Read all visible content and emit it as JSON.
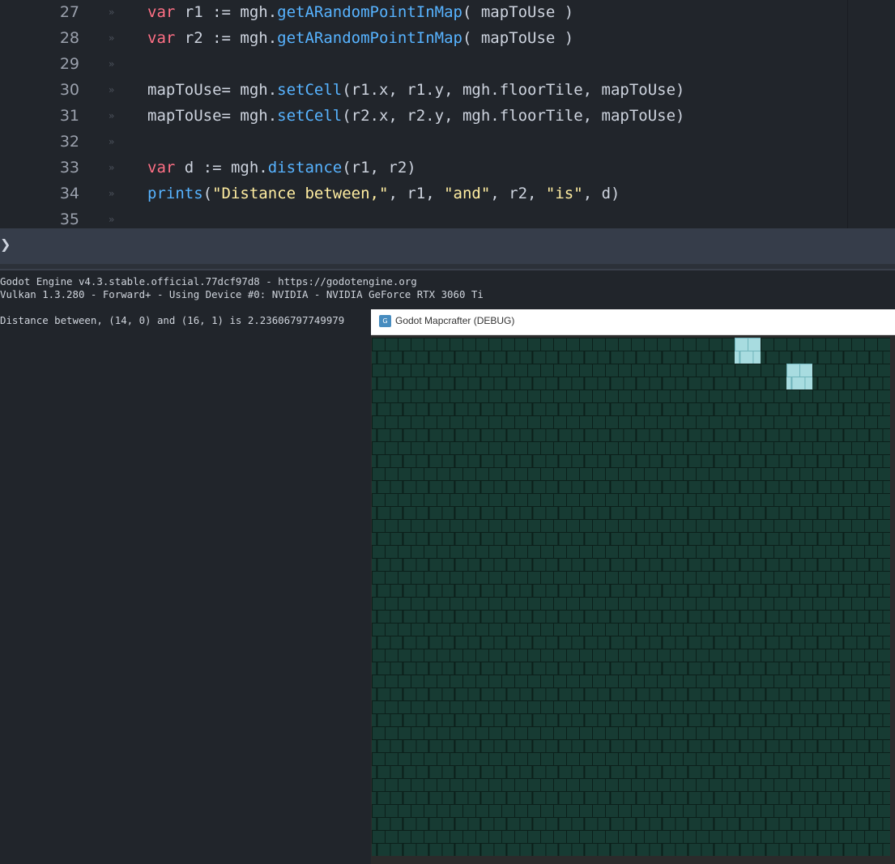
{
  "editor": {
    "lines": [
      {
        "num": "27",
        "tokens": [
          [
            "kw",
            "var"
          ],
          [
            "pl",
            " r1 := mgh."
          ],
          [
            "fn",
            "getARandomPointInMap"
          ],
          [
            "pl",
            "( mapToUse )"
          ]
        ]
      },
      {
        "num": "28",
        "tokens": [
          [
            "kw",
            "var"
          ],
          [
            "pl",
            " r2 := mgh."
          ],
          [
            "fn",
            "getARandomPointInMap"
          ],
          [
            "pl",
            "( mapToUse )"
          ]
        ]
      },
      {
        "num": "29",
        "tokens": []
      },
      {
        "num": "30",
        "tokens": [
          [
            "pl",
            "mapToUse= mgh."
          ],
          [
            "fn",
            "setCell"
          ],
          [
            "pl",
            "(r1.x, r1.y, mgh.floorTile, mapToUse)"
          ]
        ]
      },
      {
        "num": "31",
        "tokens": [
          [
            "pl",
            "mapToUse= mgh."
          ],
          [
            "fn",
            "setCell"
          ],
          [
            "pl",
            "(r2.x, r2.y, mgh.floorTile, mapToUse)"
          ]
        ]
      },
      {
        "num": "32",
        "tokens": []
      },
      {
        "num": "33",
        "tokens": [
          [
            "kw",
            "var"
          ],
          [
            "pl",
            " d := mgh."
          ],
          [
            "fn",
            "distance"
          ],
          [
            "pl",
            "(r1, r2)"
          ]
        ]
      },
      {
        "num": "34",
        "tokens": [
          [
            "fn",
            "prints"
          ],
          [
            "pl",
            "("
          ],
          [
            "str",
            "\"Distance between,\""
          ],
          [
            "pl",
            ", r1, "
          ],
          [
            "str",
            "\"and\""
          ],
          [
            "pl",
            ", r2, "
          ],
          [
            "str",
            "\"is\""
          ],
          [
            "pl",
            ", d)"
          ]
        ]
      },
      {
        "num": "35",
        "tokens": []
      }
    ],
    "tab_marker": "»"
  },
  "prompt": {
    "chevron": "❯"
  },
  "output": {
    "line1": "Godot Engine v4.3.stable.official.77dcf97d8 - https://godotengine.org",
    "line2": "Vulkan 1.3.280 - Forward+ - Using Device #0: NVIDIA - NVIDIA GeForce RTX 3060 Ti",
    "line3": "Distance between, (14, 0) and (16, 1) is 2.23606797749979"
  },
  "game_window": {
    "title": "Godot Mapcrafter (DEBUG)",
    "map": {
      "cols": 20,
      "rows": 20,
      "wall_color": "#173b33",
      "mortar_color": "#0b1f1a",
      "floor_color": "#a8dce0",
      "floor_mortar_color": "#6fb3ba",
      "floor_cells": [
        {
          "x": 14,
          "y": 0
        },
        {
          "x": 16,
          "y": 1
        }
      ]
    }
  }
}
